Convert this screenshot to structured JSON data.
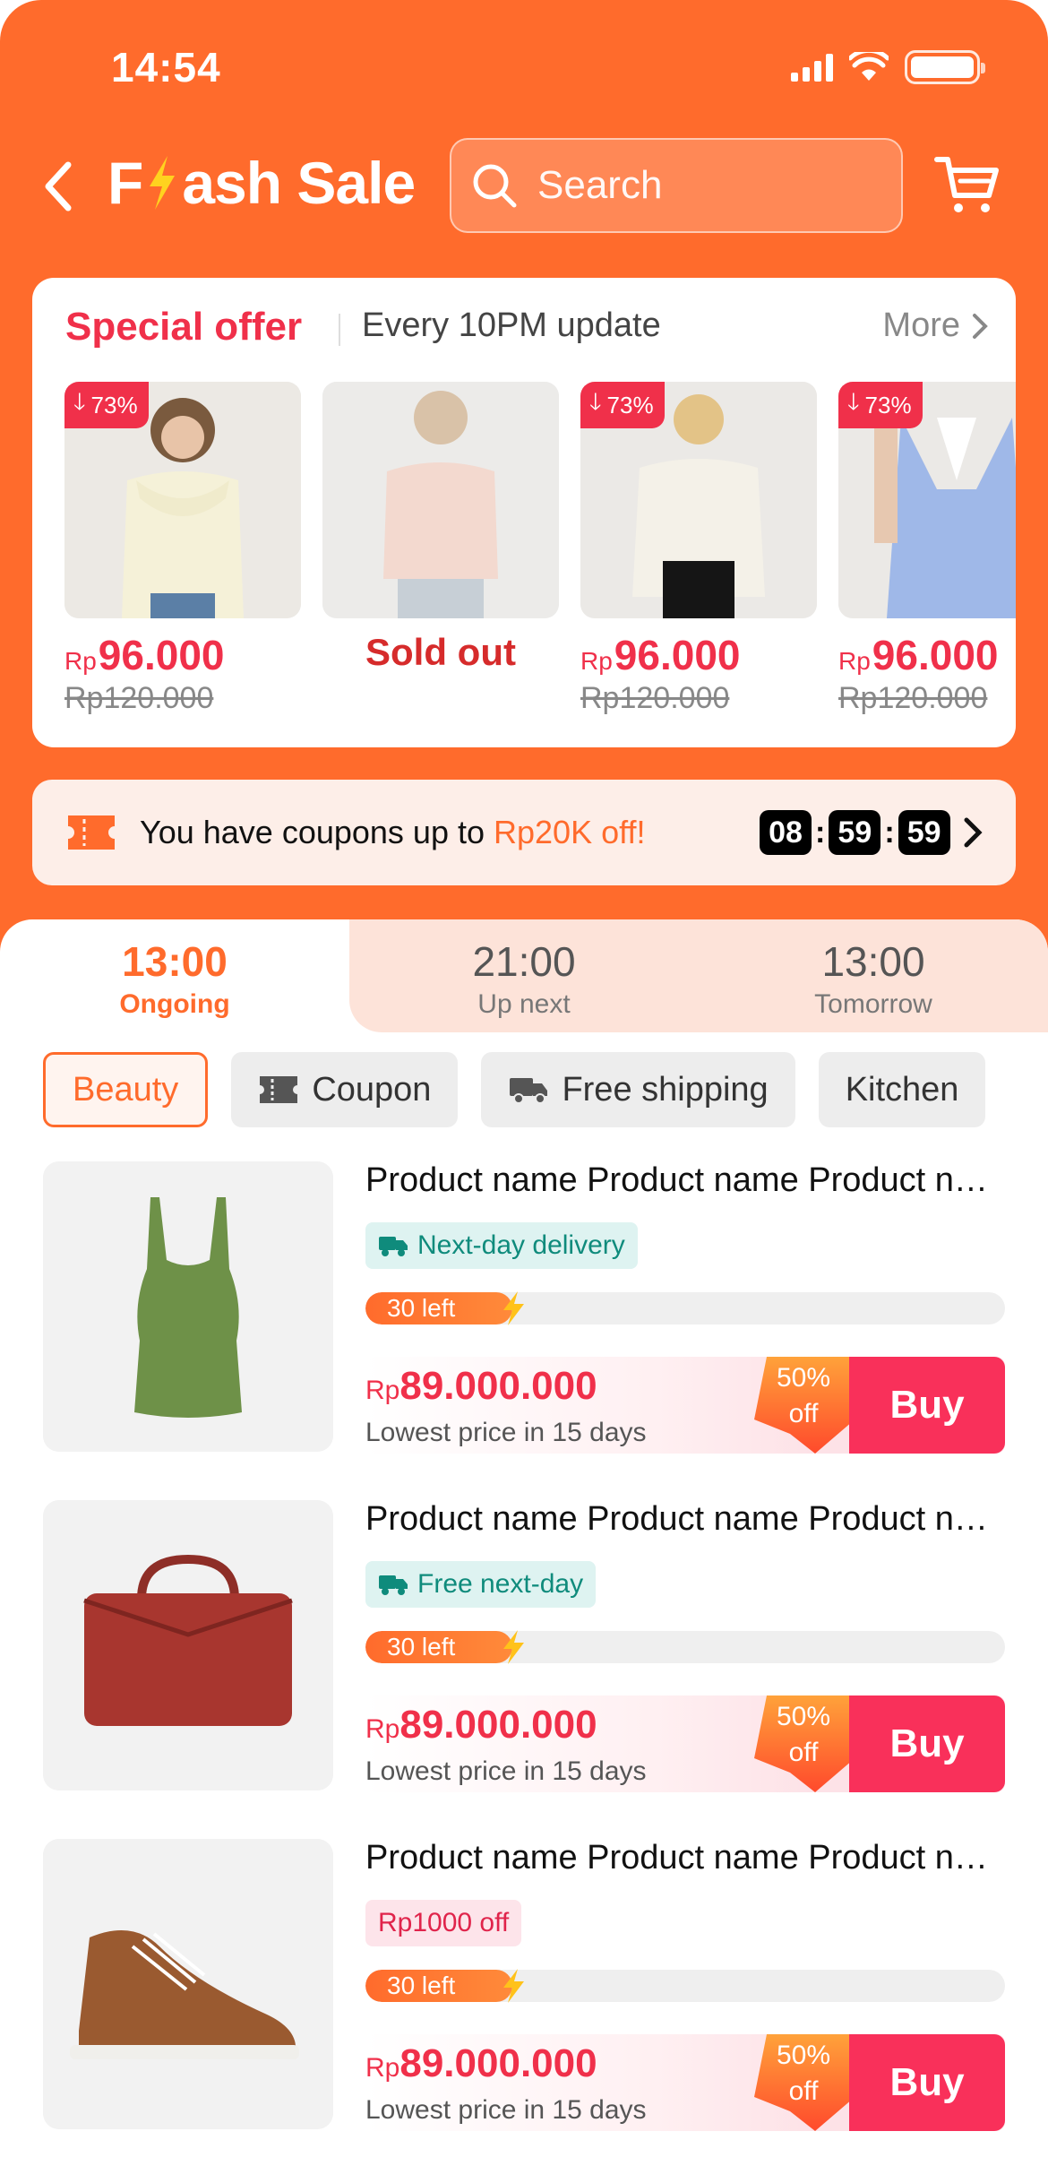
{
  "status": {
    "time": "14:54"
  },
  "header": {
    "title_prefix": "F",
    "title_suffix": "ash Sale",
    "search_placeholder": "Search"
  },
  "special_offer": {
    "title": "Special offer",
    "subtitle": "Every 10PM update",
    "more": "More",
    "items": [
      {
        "discount": "73%",
        "currency": "Rp",
        "price": "96.000",
        "old_price": "Rp120.000",
        "status": ""
      },
      {
        "discount": "",
        "currency": "",
        "price": "",
        "old_price": "",
        "status": "Sold out"
      },
      {
        "discount": "73%",
        "currency": "Rp",
        "price": "96.000",
        "old_price": "Rp120.000",
        "status": ""
      },
      {
        "discount": "73%",
        "currency": "Rp",
        "price": "96.000",
        "old_price": "Rp120.000",
        "status": ""
      }
    ]
  },
  "coupon": {
    "text_prefix": "You have coupons up to ",
    "text_highlight": "Rp20K off!",
    "timer": {
      "hours": "08",
      "minutes": "59",
      "seconds": "59"
    }
  },
  "tabs": [
    {
      "time": "13:00",
      "label": "Ongoing",
      "active": true
    },
    {
      "time": "21:00",
      "label": "Up next",
      "active": false
    },
    {
      "time": "13:00",
      "label": "Tomorrow",
      "active": false
    }
  ],
  "filters": [
    {
      "label": "Beauty",
      "active": true,
      "icon": ""
    },
    {
      "label": "Coupon",
      "active": false,
      "icon": "ticket-icon"
    },
    {
      "label": "Free shipping",
      "active": false,
      "icon": "truck-icon"
    },
    {
      "label": "Kitchen",
      "active": false,
      "icon": ""
    }
  ],
  "products": [
    {
      "name": "Product name Product name Product name",
      "badge": "Next-day delivery",
      "badge_style": "teal",
      "badge_icon": "truck-icon",
      "stock_label": "30 left",
      "stock_fraction": 0.23,
      "currency": "Rp",
      "price": "89.000.000",
      "lowest": "Lowest price in 15 days",
      "off": "50%",
      "off_word": "off",
      "buy": "Buy",
      "image": "green-tank-top"
    },
    {
      "name": "Product name Product name Product name",
      "badge": "Free next-day",
      "badge_style": "teal",
      "badge_icon": "truck-icon",
      "stock_label": "30 left",
      "stock_fraction": 0.23,
      "currency": "Rp",
      "price": "89.000.000",
      "lowest": "Lowest price in 15 days",
      "off": "50%",
      "off_word": "off",
      "buy": "Buy",
      "image": "red-handbag"
    },
    {
      "name": "Product name Product name Product name",
      "badge": "Rp1000 off",
      "badge_style": "pink",
      "badge_icon": "",
      "stock_label": "30 left",
      "stock_fraction": 0.23,
      "currency": "Rp",
      "price": "89.000.000",
      "lowest": "Lowest price in 15 days",
      "off": "50%",
      "off_word": "off",
      "buy": "Buy",
      "image": "brown-sneaker"
    }
  ],
  "colors": {
    "brand_orange": "#ff6b2c",
    "sale_red": "#f0304a",
    "buy_pink": "#f9305a",
    "teal": "#0f8b7c"
  }
}
